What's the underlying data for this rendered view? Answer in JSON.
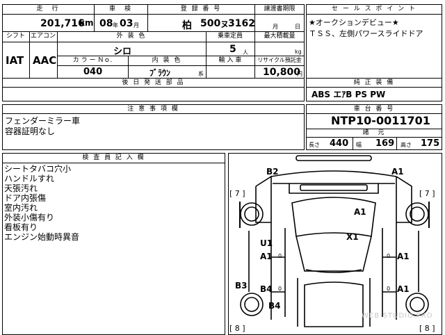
{
  "headers": {
    "mileage": "走　行",
    "inspection": "車　検",
    "registration": "登 録 番 号",
    "transfer_deadline": "譲渡書期限",
    "shift": "シフト",
    "aircon": "エアコン",
    "exterior_color": "外 装 色",
    "capacity": "乗車定員",
    "max_load": "最大積載量",
    "color_no": "カ ラ ー Ｎｏ.",
    "interior_color": "内 装 色",
    "import": "輸 入 車",
    "recycle": "リサイクル預託金",
    "later_parts": "後 日 発 送 部 品",
    "sales_point": "セ ー ル ス ポ イ ン ト",
    "equipment": "純 正 装 備",
    "notes": "注 意 事 項 欄",
    "chassis_no": "車 台 番 号",
    "dimensions": "諸　元",
    "inspector": "検 査 員 記 入 欄"
  },
  "vehicle": {
    "mileage_value": "201,716",
    "mileage_unit": "km",
    "inspection_year": "08",
    "inspection_year_unit": "年",
    "inspection_month": "03",
    "inspection_month_unit": "月",
    "reg_place": "柏",
    "reg_class": "500",
    "reg_kana": "ヌ",
    "reg_number": "3162",
    "deadline_month": "月",
    "deadline_day": "日",
    "shift_value": "IAT",
    "aircon_value": "AAC",
    "exterior_value": "シロ",
    "capacity_value": "5",
    "capacity_unit": "人",
    "max_load_unit": "kg",
    "color_no_value": "040",
    "interior_value": "ﾌﾞﾗｳﾝ",
    "interior_suffix": "系",
    "recycle_value": "10,800",
    "recycle_unit": "円",
    "chassis_value": "NTP10-0011701",
    "length_label": "長さ",
    "length_value": "440",
    "width_label": "幅",
    "width_value": "169",
    "height_label": "高さ",
    "height_value": "175"
  },
  "sales_points": [
    "★オークションデビュー★",
    "ＴＳＳ、左側パワースライドドア"
  ],
  "equipment_values": "ABS エｱB PS PW",
  "notes": [
    "フェンダーミラー車",
    "容器証明なし"
  ],
  "inspector_notes": [
    "シートタバコ穴小",
    "ハンドルすれ",
    "天張汚れ",
    "ドア内張傷",
    "室内汚れ",
    "外装小傷有り",
    "看板有り",
    "エンジン始動時異音"
  ],
  "diagram": {
    "labels": [
      "B2",
      "A1",
      "A1",
      "X1",
      "U1",
      "A1",
      "A1",
      "B3",
      "B4",
      "A1",
      "B4"
    ],
    "tire_left_top": "[ 7 ]",
    "tire_right_top": "[ 7 ]",
    "tire_left_bottom": "[ 8 ]",
    "tire_right_bottom": "[ 8 ]",
    "zero": "0"
  },
  "watermark": "WEB-STUDIO.PRO"
}
